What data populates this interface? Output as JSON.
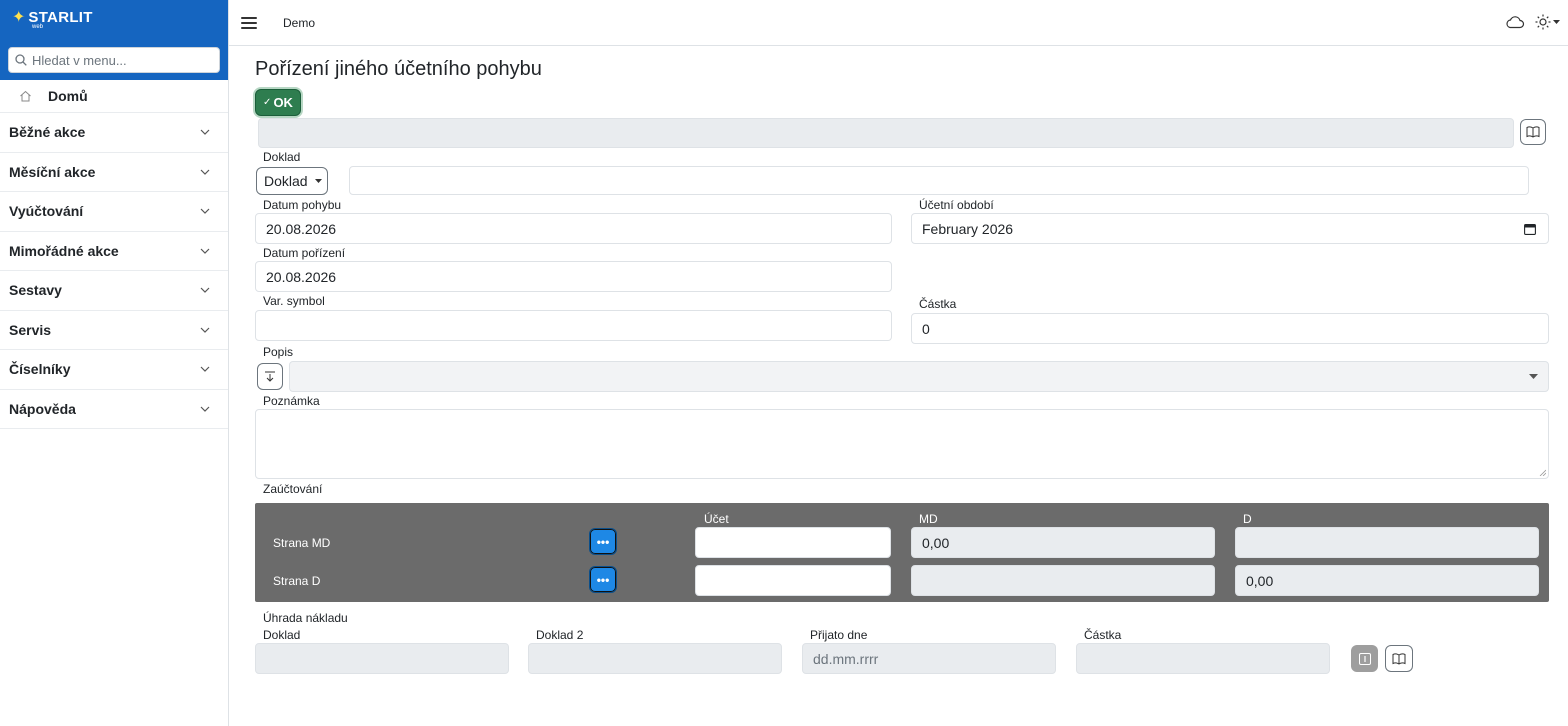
{
  "brand": {
    "name": "STARLIT",
    "sub": "web"
  },
  "search": {
    "placeholder": "Hledat v menu..."
  },
  "sidebar": {
    "home": "Domů",
    "items": [
      {
        "label": "Běžné akce"
      },
      {
        "label": "Měsíční akce"
      },
      {
        "label": "Vyúčtování"
      },
      {
        "label": "Mimořádné akce"
      },
      {
        "label": "Sestavy"
      },
      {
        "label": "Servis"
      },
      {
        "label": "Číselníky"
      },
      {
        "label": "Nápověda"
      }
    ]
  },
  "topbar": {
    "crumb": "Demo"
  },
  "page": {
    "title": "Pořízení jiného účetního pohybu",
    "ok_label": "OK"
  },
  "form": {
    "doklad_label": "Doklad",
    "doklad_dropdown": "Doklad",
    "doklad_value": "",
    "datum_pohybu_label": "Datum pohybu",
    "datum_pohybu_value": "20.08.2026",
    "ucetni_obdobi_label": "Účetní období",
    "ucetni_obdobi_value": "February 2026",
    "datum_porizeni_label": "Datum pořízení",
    "datum_porizeni_value": "20.08.2026",
    "var_symbol_label": "Var. symbol",
    "var_symbol_value": "",
    "castka_label": "Částka",
    "castka_value": "0",
    "popis_label": "Popis",
    "poznamka_label": "Poznámka",
    "zauctovani_label": "Zaúčtování"
  },
  "posting": {
    "col_ucet": "Účet",
    "col_md": "MD",
    "col_d": "D",
    "rows": [
      {
        "label": "Strana MD",
        "ucet": "",
        "md": "0,00",
        "d": ""
      },
      {
        "label": "Strana D",
        "ucet": "",
        "md": "",
        "d": "0,00"
      }
    ]
  },
  "uhrada": {
    "title": "Úhrada nákladu",
    "doklad_label": "Doklad",
    "doklad2_label": "Doklad 2",
    "prijato_label": "Přijato dne",
    "prijato_placeholder": "dd.mm.rrrr",
    "castka_label": "Částka"
  },
  "colors": {
    "brand": "#1565c0",
    "ok": "#2e7d4f",
    "posting_bg": "#6b6b6b",
    "dots_btn": "#1e88e5"
  }
}
